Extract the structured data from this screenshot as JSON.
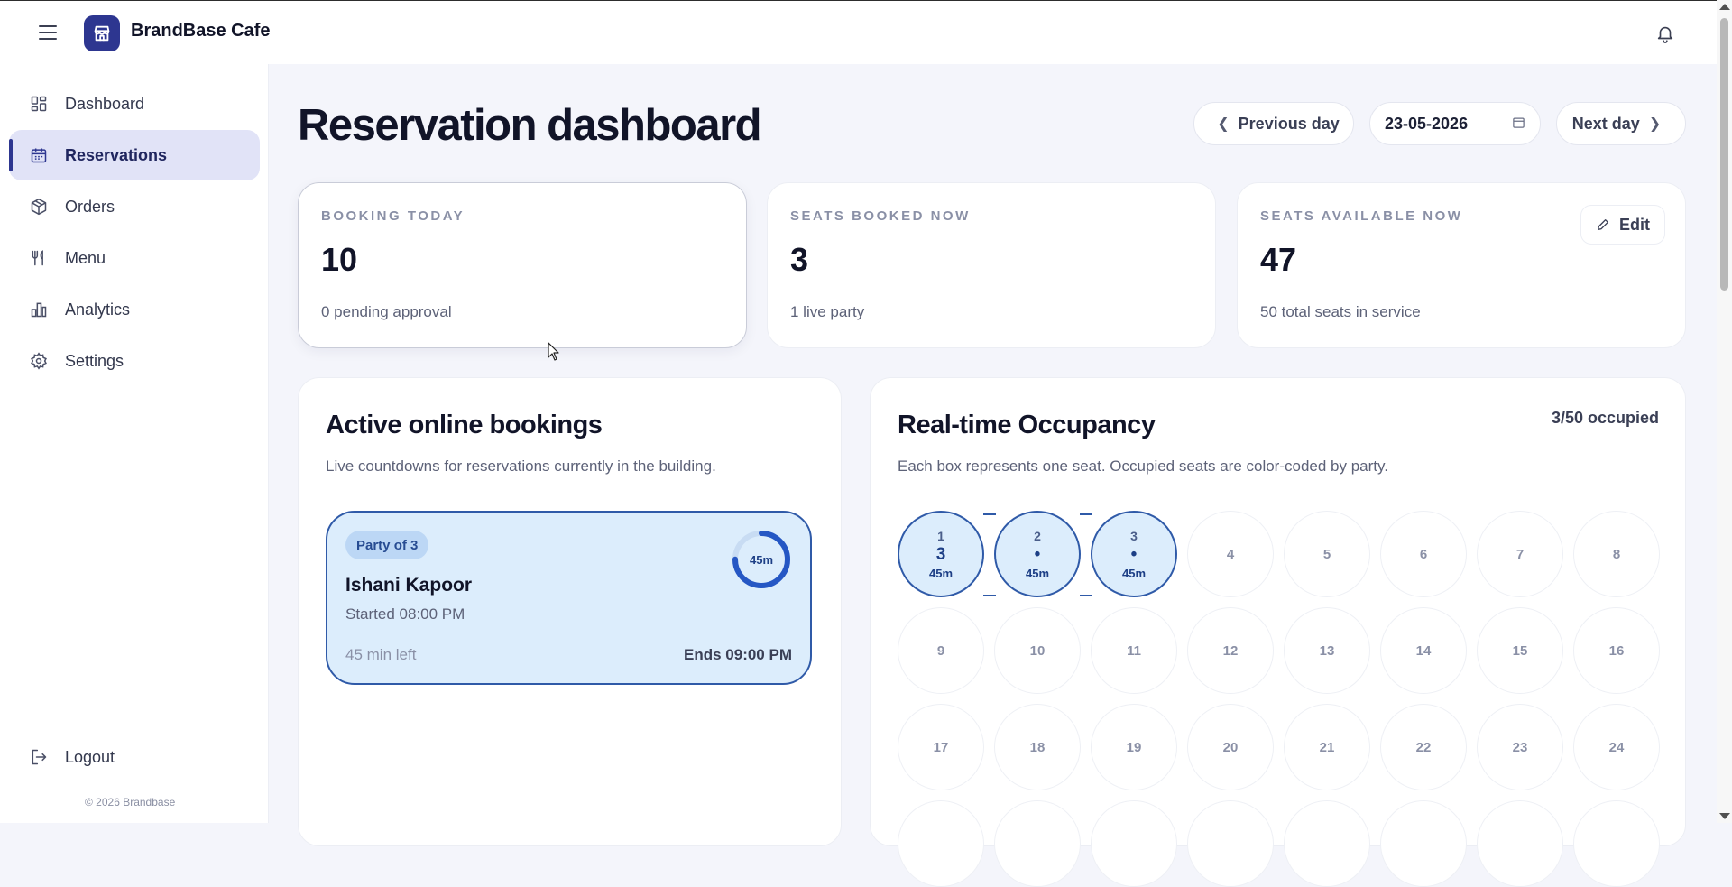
{
  "header": {
    "brand_name": "BrandBase Cafe"
  },
  "sidebar": {
    "items": [
      {
        "label": "Dashboard",
        "icon": "grid-icon"
      },
      {
        "label": "Reservations",
        "icon": "calendar-icon",
        "active": true
      },
      {
        "label": "Orders",
        "icon": "box-icon"
      },
      {
        "label": "Menu",
        "icon": "utensils-icon"
      },
      {
        "label": "Analytics",
        "icon": "bar-chart-icon"
      },
      {
        "label": "Settings",
        "icon": "gear-icon"
      }
    ],
    "logout_label": "Logout",
    "copyright": "© 2026 Brandbase"
  },
  "main": {
    "title": "Reservation dashboard",
    "prev_day_label": "Previous day",
    "date_value": "23-05-2026",
    "next_day_label": "Next day"
  },
  "stats": [
    {
      "label": "BOOKING TODAY",
      "value": "10",
      "sub": "0 pending approval"
    },
    {
      "label": "SEATS BOOKED NOW",
      "value": "3",
      "sub": "1 live party"
    },
    {
      "label": "SEATS AVAILABLE NOW",
      "value": "47",
      "sub": "50 total seats in service",
      "edit_label": "Edit"
    }
  ],
  "active_bookings": {
    "title": "Active online bookings",
    "description": "Live countdowns for reservations currently in the building.",
    "bookings": [
      {
        "party_label": "Party of 3",
        "guest": "Ishani Kapoor",
        "started": "Started 08:00 PM",
        "time_left": "45 min left",
        "ends": "Ends 09:00 PM",
        "ring_label": "45m",
        "ring_progress": 0.75
      }
    ]
  },
  "occupancy": {
    "title": "Real-time Occupancy",
    "description": "Each box represents one seat. Occupied seats are color-coded by party.",
    "count_label": "3/50 occupied",
    "occupied_seats": [
      {
        "number": "1",
        "party": "3",
        "time": "45m"
      },
      {
        "number": "2",
        "party": "•",
        "time": "45m"
      },
      {
        "number": "3",
        "party": "•",
        "time": "45m"
      }
    ],
    "seat_numbers": [
      "4",
      "5",
      "6",
      "7",
      "8",
      "9",
      "10",
      "11",
      "12",
      "13",
      "14",
      "15",
      "16",
      "17",
      "18",
      "19",
      "20",
      "21",
      "22",
      "23",
      "24"
    ]
  },
  "colors": {
    "brand": "#2d3690",
    "occupied_fill": "#dcedfc",
    "occupied_border": "#2f5aa8",
    "active_nav": "#e1e3f7"
  }
}
